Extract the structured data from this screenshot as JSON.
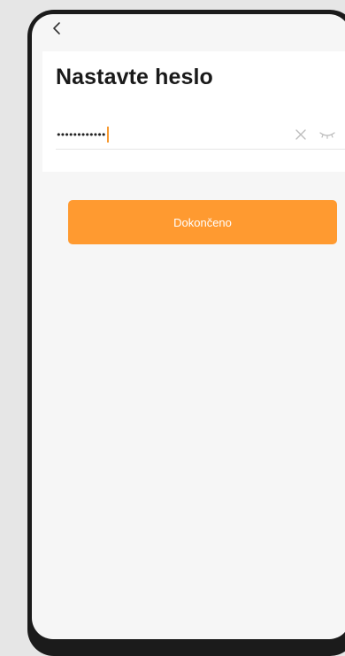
{
  "header": {
    "back_icon": "chevron-left-icon"
  },
  "form": {
    "title": "Nastavte heslo",
    "password_value": "••••••••••••",
    "clear_icon": "close-icon",
    "visibility_icon": "eye-closed-icon"
  },
  "actions": {
    "done_label": "Dokončeno"
  },
  "colors": {
    "accent": "#ff9a30",
    "background": "#f6f6f6",
    "card": "#ffffff",
    "title_text": "#1a1a1a",
    "frame": "#1b1b1b"
  }
}
